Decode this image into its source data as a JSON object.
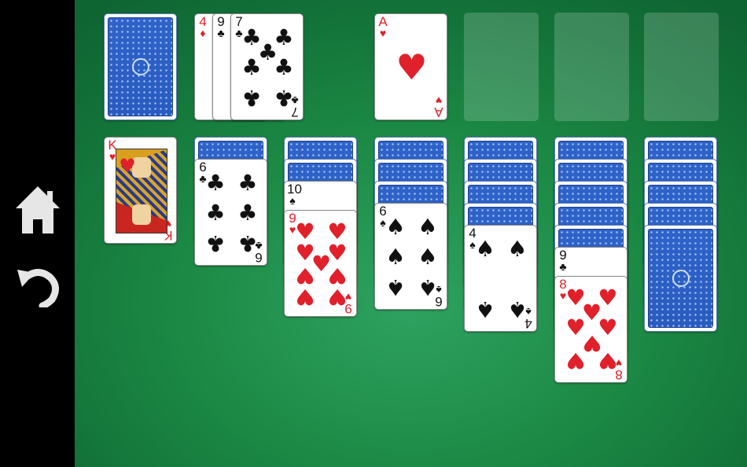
{
  "sidebar": {
    "home_icon": "home-icon",
    "undo_icon": "undo-icon"
  },
  "suits": {
    "hearts": "♥",
    "clubs": "♣",
    "spades": "♠",
    "diamonds": "♦"
  },
  "colors": {
    "felt": "#1c8a45",
    "card_back": "#2f63c9",
    "red_suit": "#e0202a"
  },
  "stock": {
    "face_down": true
  },
  "waste": [
    {
      "rank": "4",
      "suit": "♦"
    },
    {
      "rank": "9",
      "suit": "♣"
    },
    {
      "rank": "7",
      "suit": "♣"
    }
  ],
  "foundations": [
    {
      "rank": "A",
      "suit": "♥"
    },
    {
      "empty": true
    },
    {
      "empty": true
    },
    {
      "empty": true
    }
  ],
  "tableau": [
    {
      "hidden": 0,
      "cards": [
        {
          "rank": "K",
          "suit": "♥"
        }
      ]
    },
    {
      "hidden": 1,
      "cards": [
        {
          "rank": "6",
          "suit": "♣"
        }
      ]
    },
    {
      "hidden": 2,
      "cards": [
        {
          "rank": "10",
          "suit": "♠"
        },
        {
          "rank": "9",
          "suit": "♥"
        }
      ]
    },
    {
      "hidden": 3,
      "cards": [
        {
          "rank": "6",
          "suit": "♠"
        }
      ]
    },
    {
      "hidden": 4,
      "cards": [
        {
          "rank": "4",
          "suit": "♠"
        }
      ]
    },
    {
      "hidden": 5,
      "cards": [
        {
          "rank": "9",
          "suit": "♣"
        },
        {
          "rank": "8",
          "suit": "♥"
        }
      ]
    },
    {
      "hidden": 5,
      "cards": []
    }
  ]
}
